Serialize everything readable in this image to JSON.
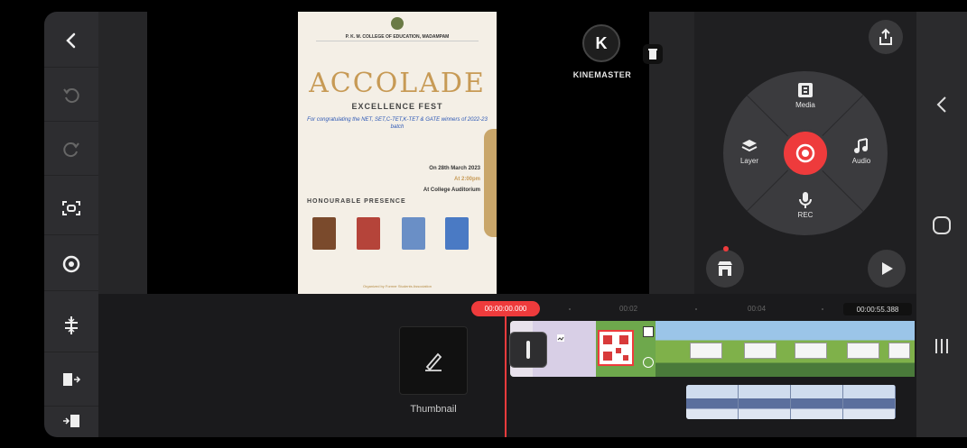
{
  "watermark": {
    "logo_letter": "K",
    "text": "KINEMASTER"
  },
  "poster": {
    "college": "P. K. M. COLLEGE OF EDUCATION, MADAMPAM",
    "headline": "ACCOLADE",
    "subheadline": "EXCELLENCE FEST",
    "congrats": "For congratulating the NET, SET,C-TET,K-TET & GATE winners of 2022-23 batch",
    "date": "On 28th March 2023",
    "time": "At 2:00pm",
    "venue": "At College Auditorium",
    "honour_heading": "HONOURABLE PRESENCE",
    "footer": "Organized by Former Students Association"
  },
  "wheel": {
    "media": "Media",
    "layer": "Layer",
    "audio": "Audio",
    "rec": "REC"
  },
  "timeline": {
    "current_time": "00:00:00.000",
    "ticks": [
      "00:02",
      "00:04"
    ],
    "total_time": "00:00:55.388",
    "thumbnail_label": "Thumbnail"
  },
  "colors": {
    "accent": "#ee3b3c",
    "panel": "#2d2d30",
    "timeline_bg": "#1a1a1c"
  },
  "icons": {
    "left_rail": [
      "back-icon",
      "undo-icon",
      "redo-icon",
      "screen-capture-icon",
      "settings-icon",
      "split-icon",
      "trim-right-icon",
      "trim-left-icon"
    ],
    "system_nav": [
      "nav-back-icon",
      "home-icon",
      "recents-icon"
    ]
  }
}
